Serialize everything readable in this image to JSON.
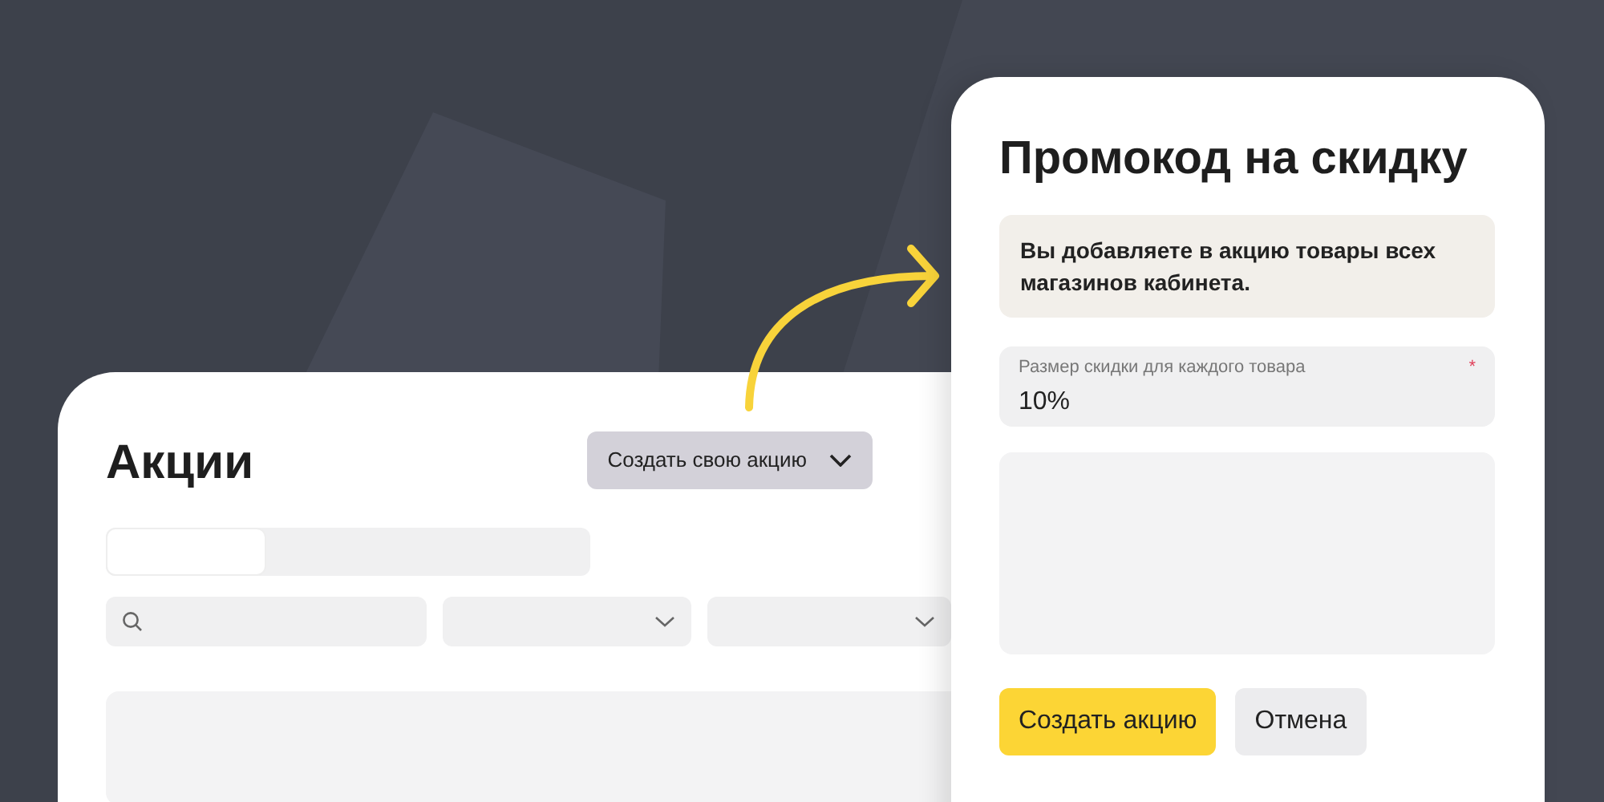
{
  "promotions_page": {
    "title": "Акции",
    "create_button": {
      "label": "Создать свою акцию"
    }
  },
  "dialog": {
    "title": "Промокод на скидку",
    "notice": "Вы добавляете в акцию товары всех магазинов кабинета.",
    "discount_field": {
      "label": "Размер скидки для каждого товара",
      "required_mark": "*",
      "value": "10%"
    },
    "buttons": [
      {
        "label": "Создать акцию",
        "kind": "primary"
      },
      {
        "label": "Отмена",
        "kind": "secondary"
      }
    ]
  }
}
